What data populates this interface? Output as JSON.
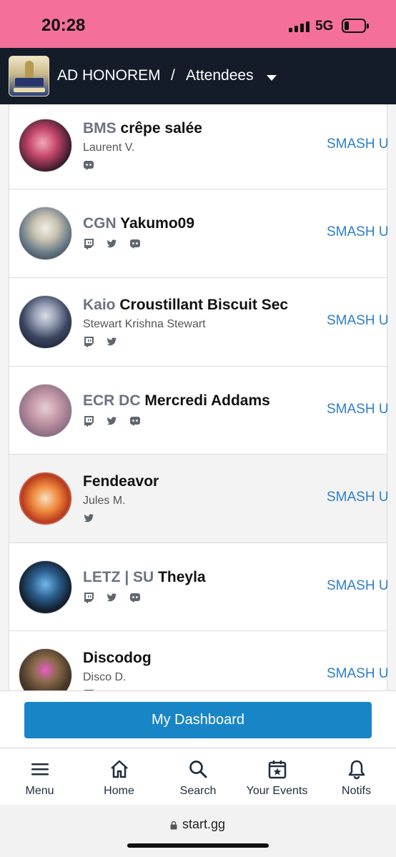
{
  "status_bar": {
    "time": "20:28",
    "network": "5G"
  },
  "header": {
    "event_title": "AD HONOREM",
    "separator": "/",
    "page_title": "Attendees"
  },
  "attendees": [
    {
      "prefix": "BMS",
      "tag": "crêpe salée",
      "real_name": "Laurent V.",
      "socials": [
        "discord"
      ],
      "action": "SMASH U"
    },
    {
      "prefix": "CGN",
      "tag": "Yakumo09",
      "real_name": "",
      "socials": [
        "twitch",
        "twitter",
        "discord"
      ],
      "action": "SMASH U"
    },
    {
      "prefix": "Kaio",
      "tag": "Croustillant Biscuit Sec",
      "real_name": "Stewart Krishna Stewart",
      "socials": [
        "twitch",
        "twitter"
      ],
      "action": "SMASH U"
    },
    {
      "prefix": "ECR DC",
      "tag": "Mercredi Addams",
      "real_name": "",
      "socials": [
        "twitch",
        "twitter",
        "discord"
      ],
      "action": "SMASH U"
    },
    {
      "prefix": "",
      "tag": "Fendeavor",
      "real_name": "Jules M.",
      "socials": [
        "twitter"
      ],
      "action": "SMASH U"
    },
    {
      "prefix": "LETZ | SU",
      "tag": "Theyla",
      "real_name": "",
      "socials": [
        "twitch",
        "twitter",
        "discord"
      ],
      "action": "SMASH U"
    },
    {
      "prefix": "",
      "tag": "Discodog",
      "real_name": "Disco D.",
      "socials": [
        "twitch",
        "twitter",
        "discord"
      ],
      "action": "SMASH U"
    }
  ],
  "dashboard_button": "My Dashboard",
  "bottom_nav": [
    {
      "label": "Menu",
      "icon": "menu-icon"
    },
    {
      "label": "Home",
      "icon": "home-icon"
    },
    {
      "label": "Search",
      "icon": "search-icon"
    },
    {
      "label": "Your Events",
      "icon": "calendar-icon"
    },
    {
      "label": "Notifs",
      "icon": "bell-icon"
    }
  ],
  "url_bar": {
    "url": "start.gg"
  },
  "colors": {
    "status_bar": "#f4709a",
    "header": "#141c2a",
    "accent": "#1886c6",
    "link": "#2d7ec7"
  }
}
